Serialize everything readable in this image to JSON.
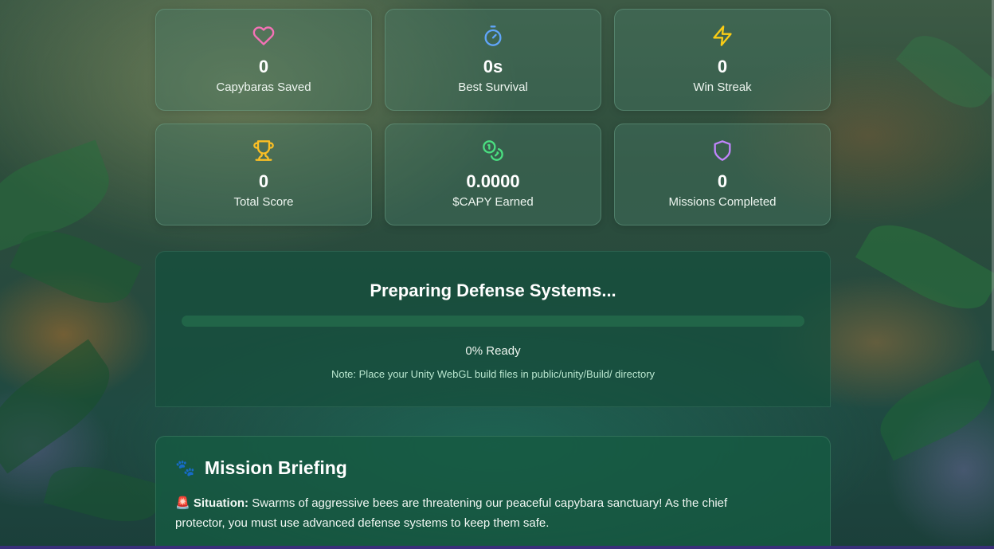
{
  "stats": [
    {
      "icon": "heart-icon",
      "color": "#f472b6",
      "value": "0",
      "label": "Capybaras Saved"
    },
    {
      "icon": "stopwatch-icon",
      "color": "#60a5fa",
      "value": "0s",
      "label": "Best Survival"
    },
    {
      "icon": "lightning-icon",
      "color": "#facc15",
      "value": "0",
      "label": "Win Streak"
    },
    {
      "icon": "trophy-icon",
      "color": "#fbbf24",
      "value": "0",
      "label": "Total Score"
    },
    {
      "icon": "coins-icon",
      "color": "#4ade80",
      "value": "0.0000",
      "label": "$CAPY Earned"
    },
    {
      "icon": "shield-icon",
      "color": "#c084fc",
      "value": "0",
      "label": "Missions Completed"
    }
  ],
  "loading": {
    "title": "Preparing Defense Systems...",
    "progress_percent": 0,
    "progress_text": "0% Ready",
    "note": "Note: Place your Unity WebGL build files in public/unity/Build/ directory"
  },
  "briefing": {
    "title_icon": "🐾",
    "title": "Mission Briefing",
    "situation_icon": "🚨",
    "situation_label": "Situation:",
    "situation_text": "Swarms of aggressive bees are threatening our peaceful capybara sanctuary! As the chief protector, you must use advanced defense systems to keep them safe."
  }
}
